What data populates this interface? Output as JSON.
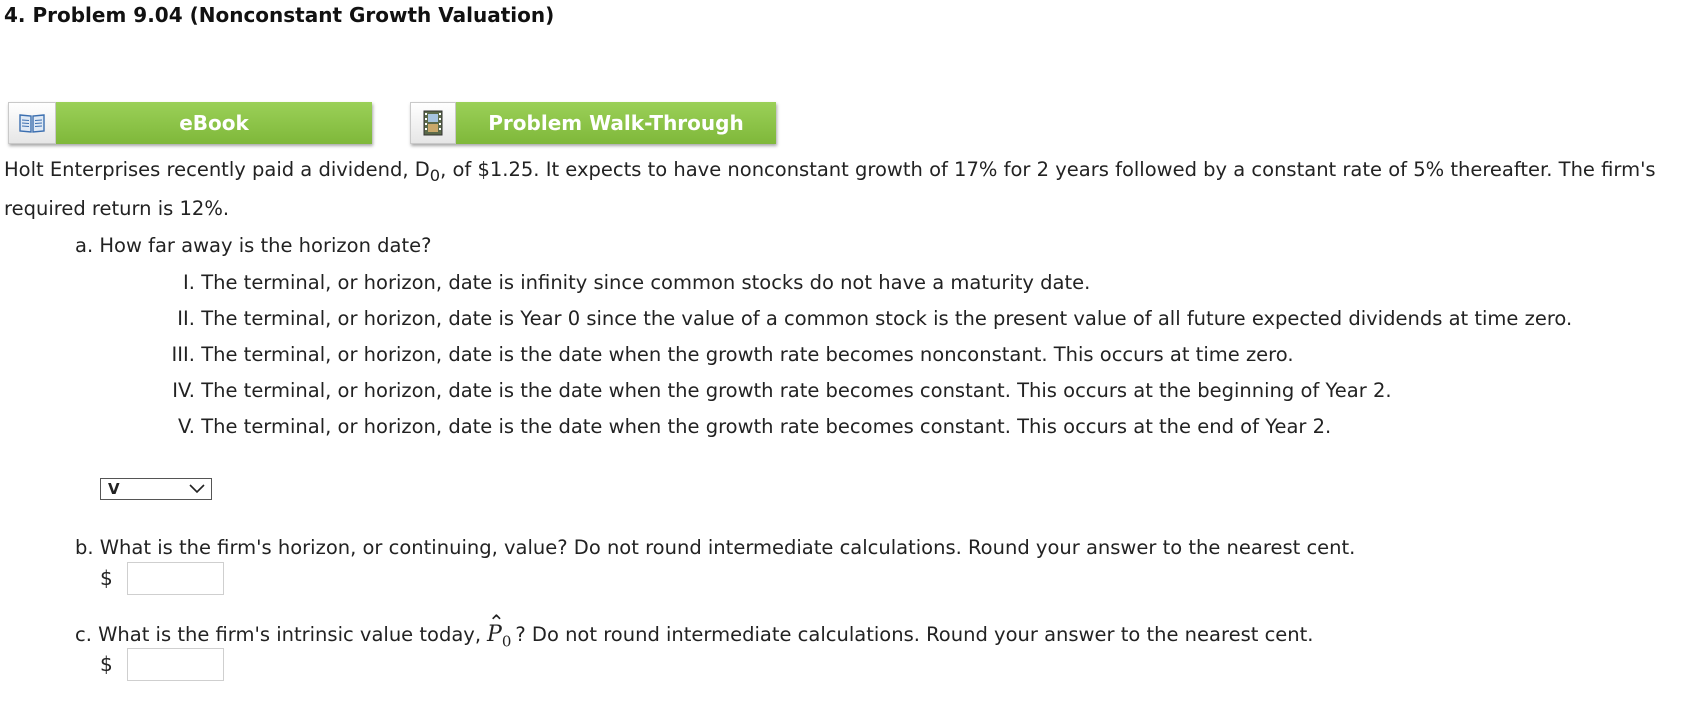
{
  "title": "4.  Problem 9.04 (Nonconstant Growth Valuation)",
  "buttons": {
    "ebook": "eBook",
    "walkthrough": "Problem Walk-Through"
  },
  "intro": {
    "part1": "Holt Enterprises recently paid a dividend, D",
    "sub": "0",
    "part2": ", of $1.25. It expects to have nonconstant growth of 17% for 2 years followed by a constant rate of 5% thereafter. The firm's required return is 12%."
  },
  "question_a": {
    "text": "a. How far away is the horizon date?",
    "options": [
      {
        "num": "I.",
        "text": "The terminal, or horizon, date is infinity since common stocks do not have a maturity date."
      },
      {
        "num": "II.",
        "text": "The terminal, or horizon, date is Year 0 since the value of a common stock is the present value of all future expected dividends at time zero."
      },
      {
        "num": "III.",
        "text": "The terminal, or horizon, date is the date when the growth rate becomes nonconstant. This occurs at time zero."
      },
      {
        "num": "IV.",
        "text": "The terminal, or horizon, date is the date when the growth rate becomes constant. This occurs at the beginning of Year 2."
      },
      {
        "num": "V.",
        "text": "The terminal, or horizon, date is the date when the growth rate becomes constant. This occurs at the end of Year 2."
      }
    ],
    "selected": "V"
  },
  "question_b": {
    "text": "b. What is the firm's horizon, or continuing, value? Do not round intermediate calculations. Round your answer to the nearest cent.",
    "currency": "$",
    "value": ""
  },
  "question_c": {
    "text_before": "c. What is the firm's intrinsic value today,",
    "symbol": "P",
    "symbol_sub": "0",
    "text_after": "? Do not round intermediate calculations. Round your answer to the nearest cent.",
    "currency": "$",
    "value": ""
  },
  "icons": {
    "ebook": "book-icon",
    "walkthrough": "film-icon"
  },
  "colors": {
    "button_green": "#8cc34a",
    "text": "#222222"
  }
}
